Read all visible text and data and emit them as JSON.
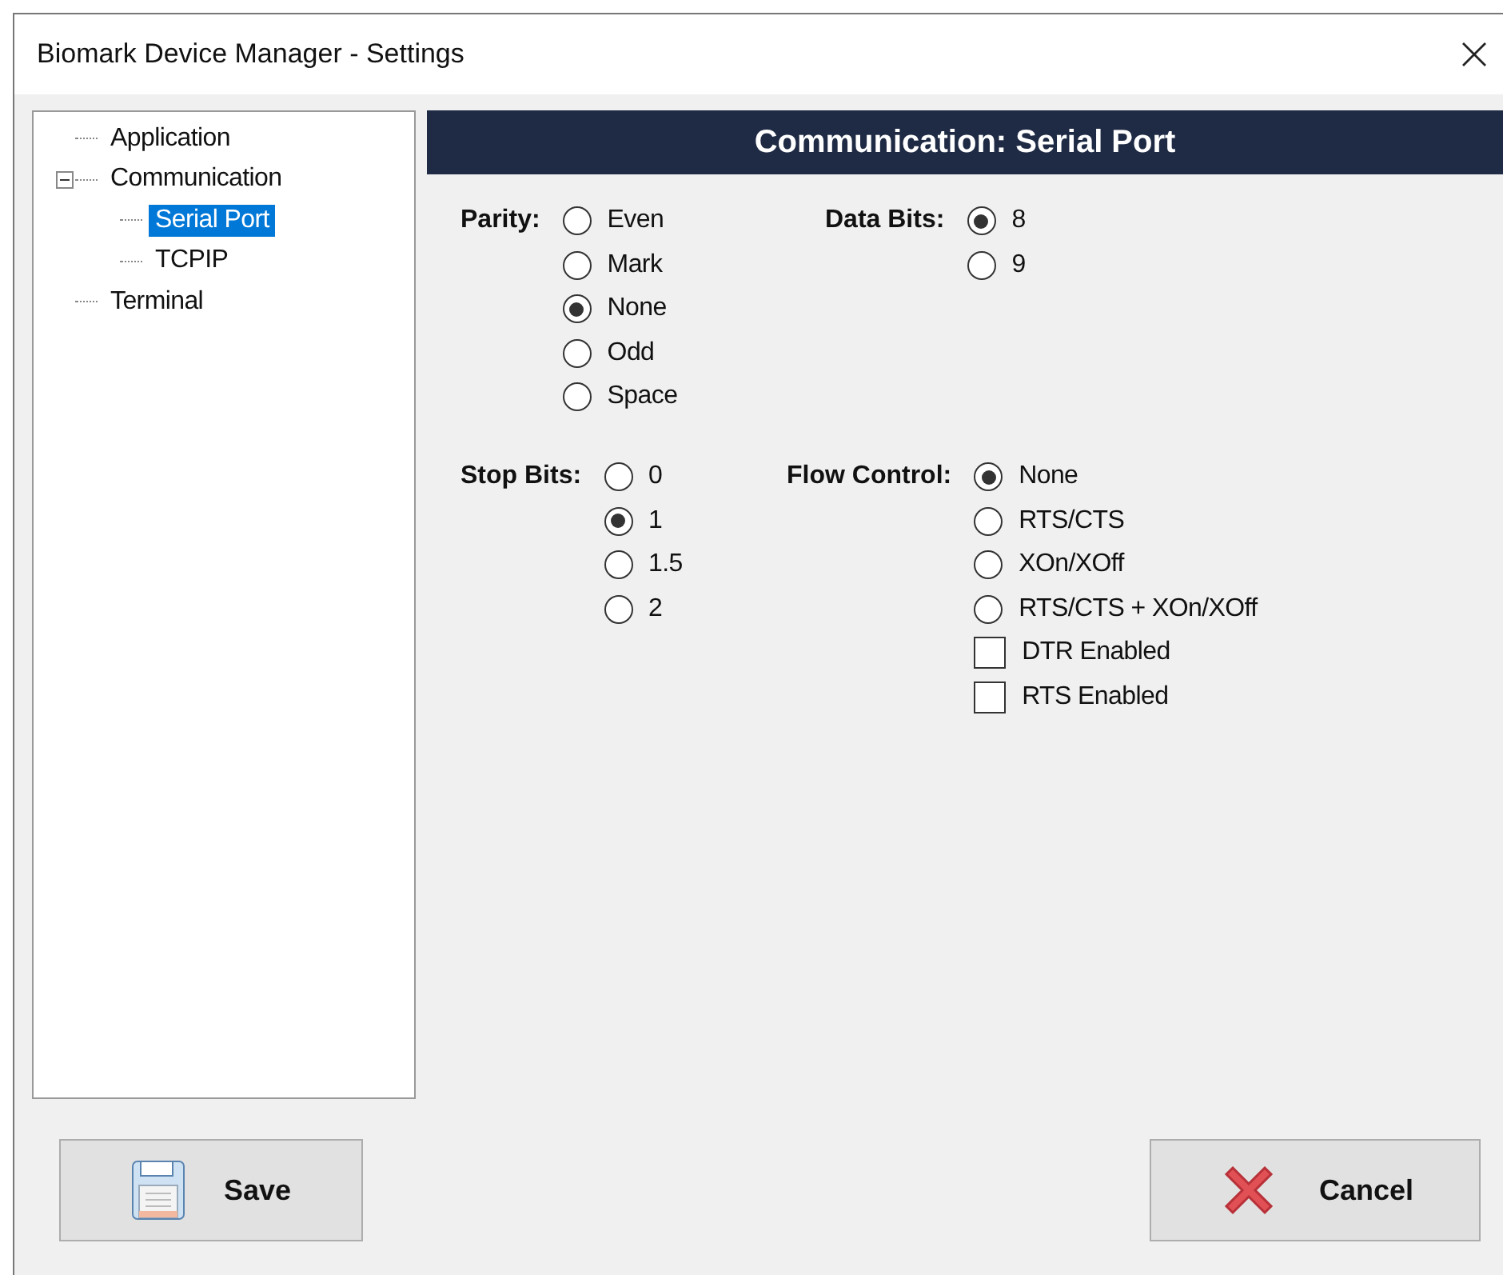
{
  "window": {
    "title": "Biomark Device Manager - Settings"
  },
  "tree": [
    {
      "label": "Application",
      "selected": false
    },
    {
      "label": "Communication",
      "selected": false,
      "expanded": true,
      "children": [
        {
          "label": "Serial Port",
          "selected": true
        },
        {
          "label": "TCPIP",
          "selected": false
        }
      ]
    },
    {
      "label": "Terminal",
      "selected": false
    }
  ],
  "panel": {
    "title": "Communication: Serial Port"
  },
  "rows": [
    {
      "groups": [
        {
          "label": "Parity:",
          "options": [
            {
              "kind": "radio",
              "label": "Even",
              "selected": false
            },
            {
              "kind": "radio",
              "label": "Mark",
              "selected": false
            },
            {
              "kind": "radio",
              "label": "None",
              "selected": true
            },
            {
              "kind": "radio",
              "label": "Odd",
              "selected": false
            },
            {
              "kind": "radio",
              "label": "Space",
              "selected": false
            }
          ]
        },
        {
          "label": "Data Bits:",
          "options": [
            {
              "kind": "radio",
              "label": "8",
              "selected": true
            },
            {
              "kind": "radio",
              "label": "9",
              "selected": false
            }
          ]
        }
      ]
    },
    {
      "groups": [
        {
          "label": "Stop Bits:",
          "options": [
            {
              "kind": "radio",
              "label": "0",
              "selected": false
            },
            {
              "kind": "radio",
              "label": "1",
              "selected": true
            },
            {
              "kind": "radio",
              "label": "1.5",
              "selected": false
            },
            {
              "kind": "radio",
              "label": "2",
              "selected": false
            }
          ]
        },
        {
          "label": "Flow Control:",
          "options": [
            {
              "kind": "radio",
              "label": "None",
              "selected": true
            },
            {
              "kind": "radio",
              "label": "RTS/CTS",
              "selected": false
            },
            {
              "kind": "radio",
              "label": "XOn/XOff",
              "selected": false
            },
            {
              "kind": "radio",
              "label": "RTS/CTS + XOn/XOff",
              "selected": false
            },
            {
              "kind": "checkbox",
              "label": "DTR Enabled",
              "checked": false
            },
            {
              "kind": "checkbox",
              "label": "RTS Enabled",
              "checked": false
            }
          ]
        }
      ]
    }
  ],
  "buttons": [
    {
      "kind": "save",
      "label": "Save"
    },
    {
      "kind": "cancel",
      "label": "Cancel"
    }
  ]
}
